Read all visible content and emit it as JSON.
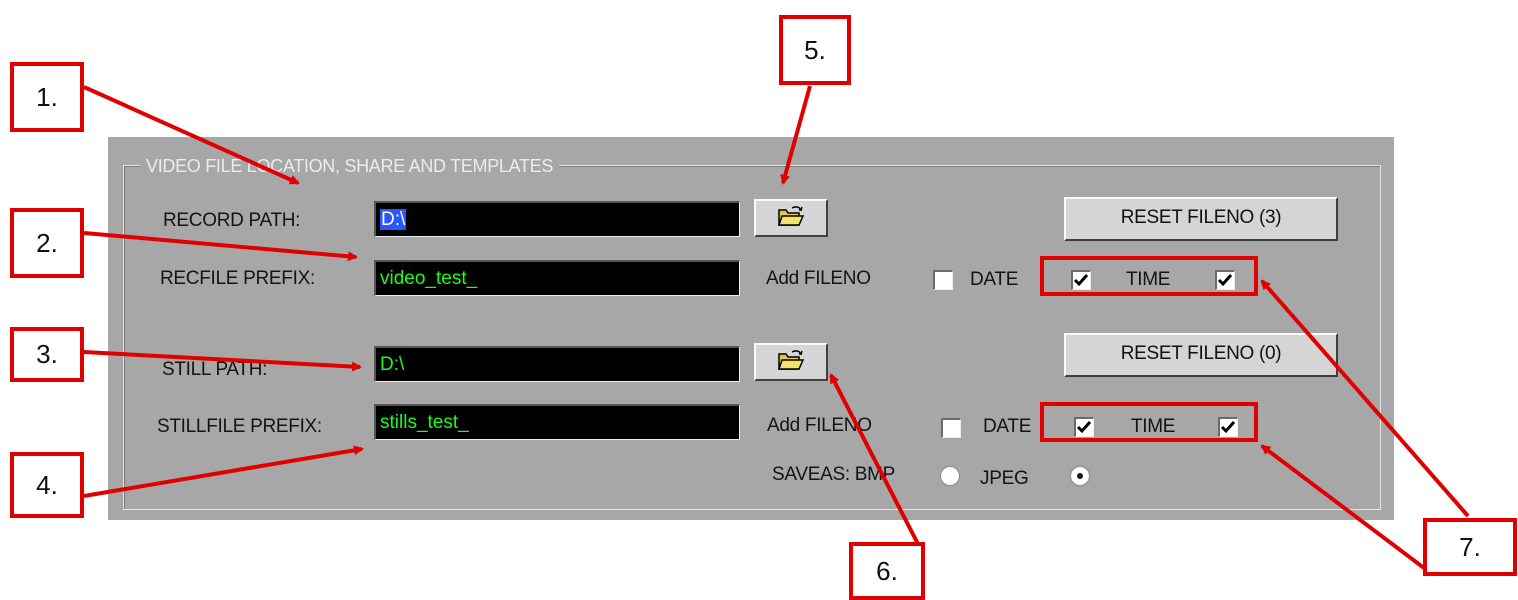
{
  "group": {
    "title": "VIDEO FILE LOCATION, SHARE AND TEMPLATES"
  },
  "record": {
    "path_label": "RECORD PATH:",
    "path_value": "D:\\",
    "prefix_label": "RECFILE PREFIX:",
    "prefix_value": "video_test_",
    "reset_button": "RESET FILENO (3)",
    "add_fileno_label": "Add FILENO",
    "add_fileno_checked": false,
    "date_label": "DATE",
    "date_checked": true,
    "time_label": "TIME",
    "time_checked": true
  },
  "still": {
    "path_label": "STILL PATH:",
    "path_value": "D:\\",
    "prefix_label": "STILLFILE PREFIX:",
    "prefix_value": "stills_test_",
    "reset_button": "RESET FILENO (0)",
    "add_fileno_label": "Add FILENO",
    "add_fileno_checked": false,
    "date_label": "DATE",
    "date_checked": true,
    "time_label": "TIME",
    "time_checked": true,
    "saveas_label": "SAVEAS: BMP",
    "jpeg_label": "JPEG",
    "saveas_selected": "JPEG"
  },
  "icons": {
    "folder": "folder-open-icon",
    "check": "checkmark-icon"
  },
  "colors": {
    "callout_red": "#e00000",
    "field_text": "#19ff19",
    "panel_gray": "#a7a7a7"
  },
  "callouts": [
    "1.",
    "2.",
    "3.",
    "4.",
    "5.",
    "6.",
    "7."
  ]
}
